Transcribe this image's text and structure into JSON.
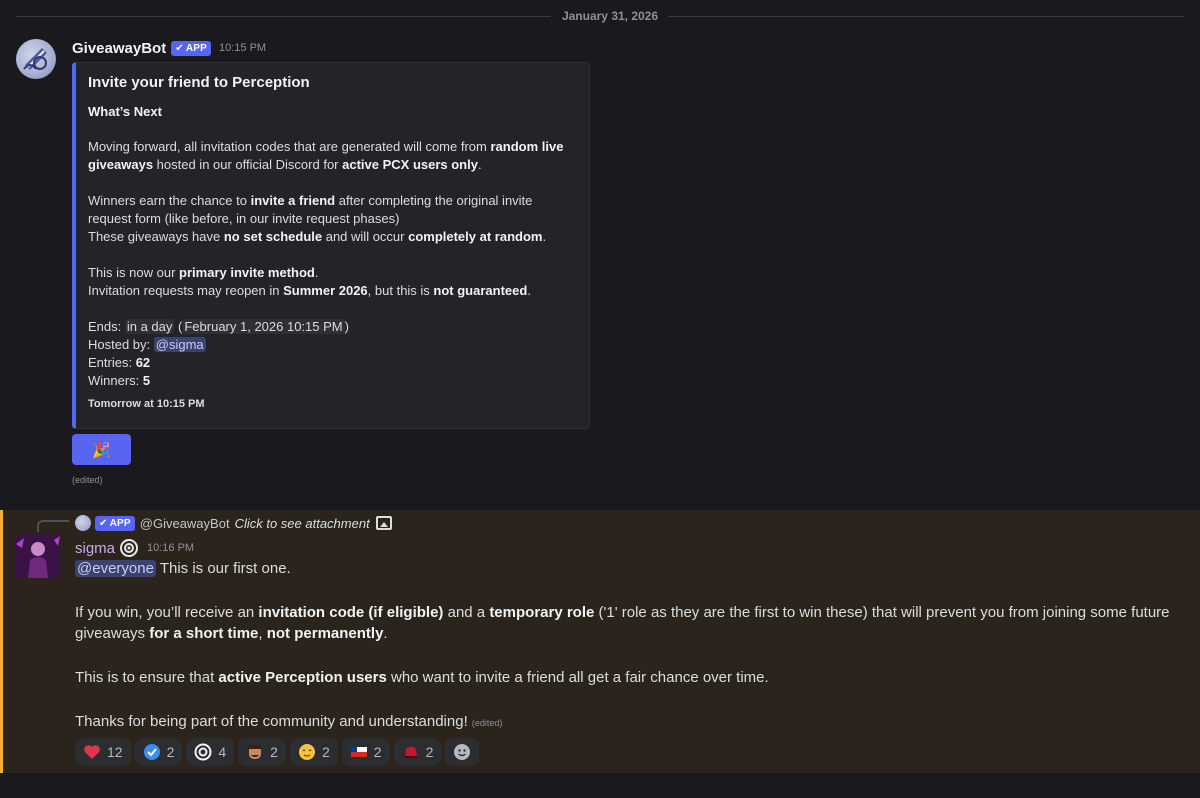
{
  "date_divider": "January 31, 2026",
  "message1": {
    "username": "GiveawayBot",
    "badge": "APP",
    "timestamp": "10:15 PM",
    "embed": {
      "title": "Invite your friend to Perception",
      "subtitle": "What’s Next",
      "p1": {
        "a": "Moving forward, all invitation codes that are generated will come from ",
        "b": "random live giveaways",
        "c": " hosted in our official Discord for ",
        "d": "active PCX users only",
        "e": "."
      },
      "p2": {
        "a": "Winners earn the chance to ",
        "b": "invite a friend",
        "c": " after completing the original invite request form (like before, in our invite request phases)",
        "d": "These giveaways have ",
        "e": "no set schedule",
        "f": " and will occur ",
        "g": "completely at random",
        "h": "."
      },
      "p3": {
        "a": "This is now our ",
        "b": "primary invite method",
        "c": ".",
        "d": "Invitation requests may reopen in ",
        "e": "Summer 2026",
        "f": ", but this is ",
        "g": "not guaranteed",
        "h": "."
      },
      "ends_label": "Ends: ",
      "ends_relative": "in a day",
      "ends_absolute": "February 1, 2026 10:15 PM",
      "hosted_label": "Hosted by: ",
      "hosted_mention": "@sigma",
      "entries_label": "Entries: ",
      "entries_value": "62",
      "winners_label": "Winners: ",
      "winners_value": "5",
      "footer": "Tomorrow at 10:15 PM"
    },
    "button_emoji": "🎉",
    "edited": "(edited)"
  },
  "message2": {
    "reply": {
      "badge": "APP",
      "name": "@GiveawayBot",
      "text": "Click to see attachment"
    },
    "username": "sigma",
    "timestamp": "10:16 PM",
    "line1_mention": "@everyone",
    "line1_text": " This is our first one.",
    "p2": {
      "a": "If you win, you’ll receive an ",
      "b": "invitation code (if eligible)",
      "c": " and a ",
      "d": "temporary role",
      "e": " ('1' role as they are the first to win these) that will prevent you from joining some future giveaways ",
      "f": "for a short time",
      "g": ", ",
      "h": "not permanently",
      "i": "."
    },
    "p3": {
      "a": "This is to ensure that ",
      "b": "active Perception users",
      "c": " who want to invite a friend all get a fair chance over time."
    },
    "p4": "Thanks for being part of the community and understanding!",
    "edited": "(edited)",
    "reactions": [
      {
        "emoji": "heart-icon",
        "count": "12"
      },
      {
        "emoji": "verified-icon",
        "count": "2"
      },
      {
        "emoji": "target-icon",
        "count": "4"
      },
      {
        "emoji": "face-icon",
        "count": "2"
      },
      {
        "emoji": "relieved-face-icon",
        "count": "2"
      },
      {
        "emoji": "chile-flag-icon",
        "count": "2"
      },
      {
        "emoji": "red-hat-icon",
        "count": "2"
      }
    ]
  },
  "colors": {
    "accent": "#5865f2",
    "highlight": "#f0b232",
    "background": "#1a1a1e"
  }
}
